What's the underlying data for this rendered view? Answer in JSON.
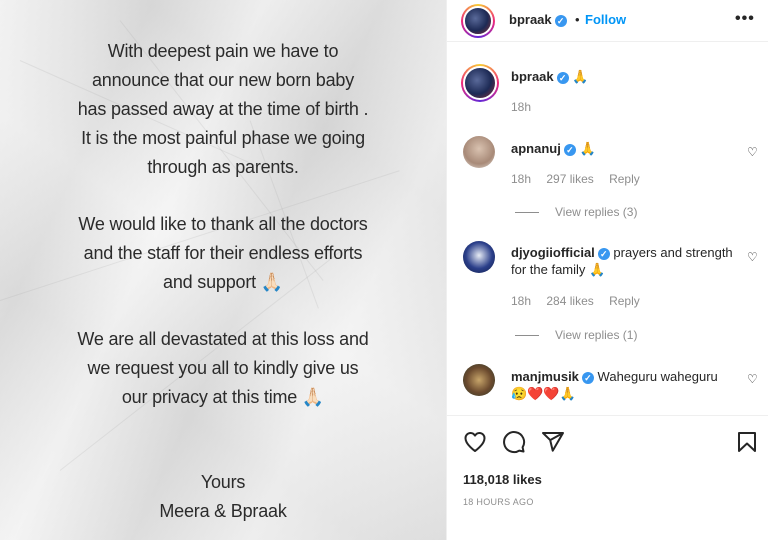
{
  "post": {
    "lines_1": [
      "With deepest pain we have to",
      "announce that our new born baby",
      "has passed away at the time of birth .",
      "It is the most painful phase we going",
      "through as parents."
    ],
    "lines_2": [
      "We would like to thank all the doctors",
      "and the staff for their endless efforts",
      "and support 🙏🏻"
    ],
    "lines_3": [
      "We are all devastated at this loss and",
      "we request you all to kindly give us",
      "our privacy at this time 🙏🏻"
    ],
    "lines_4": [
      "Yours",
      "Meera & Bpraak"
    ]
  },
  "header": {
    "username": "bpraak",
    "follow_label": "Follow",
    "separator": "•",
    "more_label": "•••"
  },
  "caption": {
    "username": "bpraak",
    "text": "🙏",
    "time": "18h"
  },
  "comments": [
    {
      "username": "apnanuj",
      "text": "🙏",
      "time": "18h",
      "likes": "297 likes",
      "reply": "Reply",
      "view_replies": "View replies (3)"
    },
    {
      "username": "djyogiiofficial",
      "text": "prayers and strength for the family 🙏",
      "time": "18h",
      "likes": "284 likes",
      "reply": "Reply",
      "view_replies": "View replies (1)"
    },
    {
      "username": "manjmusik",
      "text": "Waheguru waheguru",
      "text2": "😥❤️❤️🙏"
    }
  ],
  "footer": {
    "likes": "118,018 likes",
    "time_ago": "18 HOURS AGO"
  },
  "icons": {
    "verified": "verified-badge-icon",
    "heart": "heart-icon",
    "comment": "comment-icon",
    "share": "share-icon",
    "bookmark": "bookmark-icon",
    "more": "more-icon"
  },
  "colors": {
    "link": "#0095f6",
    "verified": "#3897f0",
    "muted": "#8e8e8e"
  }
}
